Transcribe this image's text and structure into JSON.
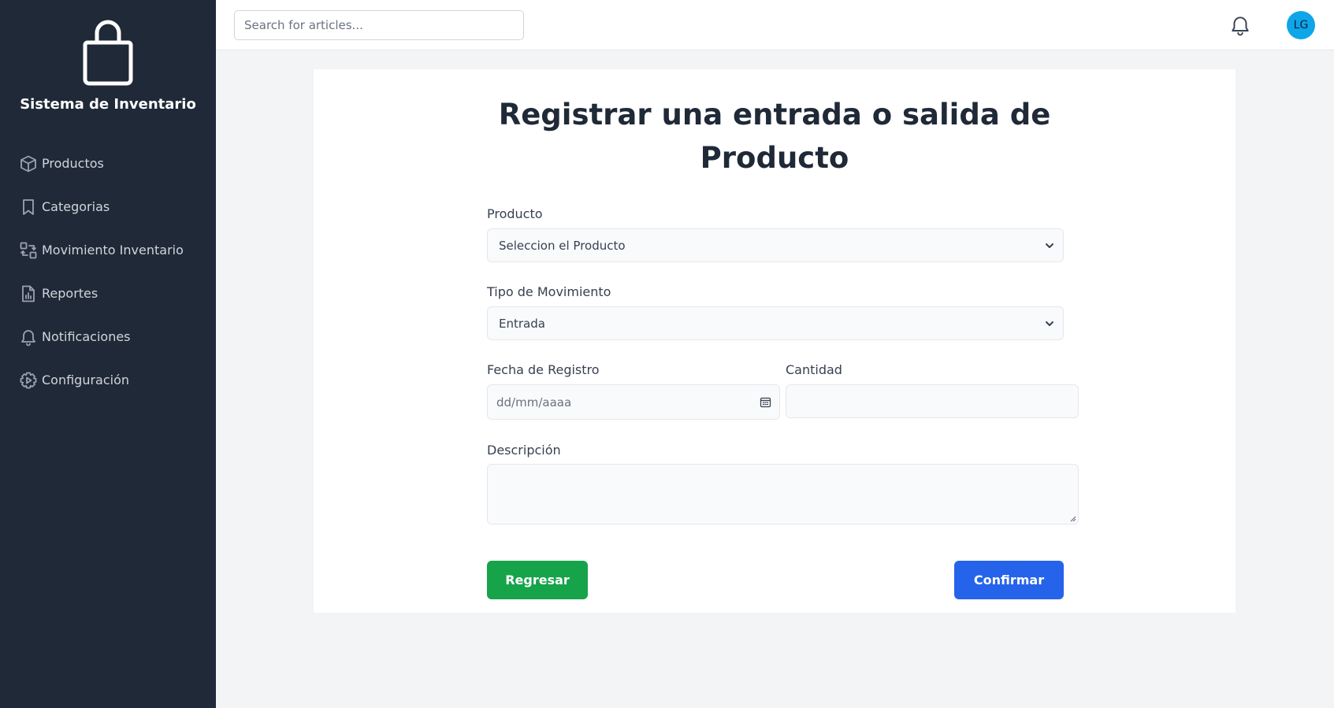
{
  "app": {
    "title": "Sistema de Inventario"
  },
  "sidebar": {
    "items": [
      {
        "label": "Productos",
        "icon": "cube-icon"
      },
      {
        "label": "Categorias",
        "icon": "bookmark-icon"
      },
      {
        "label": "Movimiento Inventario",
        "icon": "arrows-exchange-icon"
      },
      {
        "label": "Reportes",
        "icon": "report-document-icon"
      },
      {
        "label": "Notificaciones",
        "icon": "bell-icon"
      },
      {
        "label": "Configuración",
        "icon": "settings-gear-icon"
      }
    ]
  },
  "header": {
    "search": {
      "placeholder": "Search for articles..."
    },
    "user": {
      "initials": "LG"
    }
  },
  "form": {
    "title_line1": "Registrar una entrada o salida de",
    "title_line2": "Producto",
    "producto": {
      "label": "Producto",
      "selected": "Seleccion el Producto"
    },
    "tipo": {
      "label": "Tipo de Movimiento",
      "selected": "Entrada"
    },
    "fecha": {
      "label": "Fecha de Registro",
      "placeholder": "dd/mm/aaaa"
    },
    "cantidad": {
      "label": "Cantidad",
      "value": ""
    },
    "descripcion": {
      "label": "Descripción",
      "value": ""
    },
    "back_button": "Regresar",
    "confirm_button": "Confirmar"
  },
  "colors": {
    "sidebar_bg": "#1f2937",
    "back_button": "#16a34a",
    "confirm_button": "#2563eb",
    "avatar_bg": "#0ea5e9"
  }
}
